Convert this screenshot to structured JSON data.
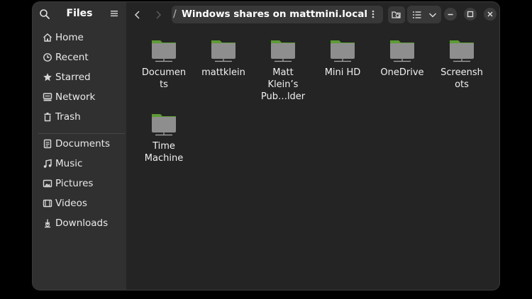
{
  "sidebar": {
    "title": "Files",
    "items": [
      {
        "label": "Home",
        "icon": "home-icon"
      },
      {
        "label": "Recent",
        "icon": "clock-icon"
      },
      {
        "label": "Starred",
        "icon": "star-icon"
      },
      {
        "label": "Network",
        "icon": "network-icon"
      },
      {
        "label": "Trash",
        "icon": "trash-icon"
      },
      {
        "label": "Documents",
        "icon": "document-icon"
      },
      {
        "label": "Music",
        "icon": "music-icon"
      },
      {
        "label": "Pictures",
        "icon": "picture-icon"
      },
      {
        "label": "Videos",
        "icon": "video-icon"
      },
      {
        "label": "Downloads",
        "icon": "download-icon"
      }
    ]
  },
  "header": {
    "path_separator": "/",
    "path": "Windows shares on mattmini.local"
  },
  "items": [
    {
      "line1": "Documen",
      "line2": "ts",
      "line3": ""
    },
    {
      "line1": "mattklein",
      "line2": "",
      "line3": ""
    },
    {
      "line1": "Matt",
      "line2": "Klein’s",
      "line3": "Pub…lder"
    },
    {
      "line1": "Mini HD",
      "line2": "",
      "line3": ""
    },
    {
      "line1": "OneDrive",
      "line2": "",
      "line3": ""
    },
    {
      "line1": "Screensh",
      "line2": "ots",
      "line3": ""
    },
    {
      "line1": "Time",
      "line2": "Machine",
      "line3": ""
    }
  ],
  "colors": {
    "folder_tab": "#5d9b34",
    "folder_body": "#8e8e8e",
    "window_bg": "#242424",
    "sidebar_bg": "#303030"
  }
}
